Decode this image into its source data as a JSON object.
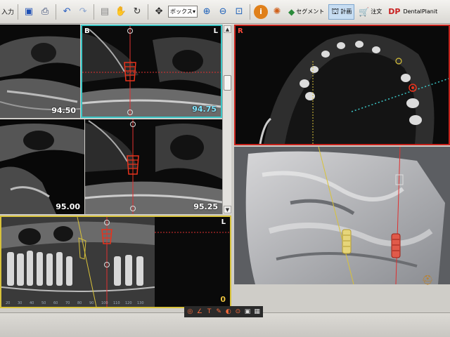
{
  "toolbar": {
    "input_label": "入力",
    "save_icon": "save-icon",
    "print_icon": "print-icon",
    "zoom_select_value": "ボックス",
    "segment_label": "セグメント",
    "plan_label": "計画",
    "order_label": "注文",
    "dp_logo": "DP",
    "dentalplanit_label": "DentalPlanit"
  },
  "views": {
    "b_view": {
      "letter_left": "B",
      "letter_right": "L",
      "slice": "94.75"
    },
    "left_top": {
      "slice": "94.50"
    },
    "left_middle": {
      "slice": "95.00"
    },
    "center_middle": {
      "slice": "95.25"
    },
    "pano": {
      "letter_right": "L",
      "value": "0"
    },
    "axial": {
      "letter_left": "R"
    }
  },
  "ruler_ticks": [
    "20",
    "30",
    "40",
    "50",
    "60",
    "70",
    "80",
    "90",
    "100",
    "110",
    "120",
    "130"
  ],
  "colors": {
    "implant_red": "#e8331c",
    "cyan_border": "#3cc7c7",
    "yellow_border": "#d8c23a",
    "red_border": "#c8231c",
    "guide_line": "#e03030"
  }
}
